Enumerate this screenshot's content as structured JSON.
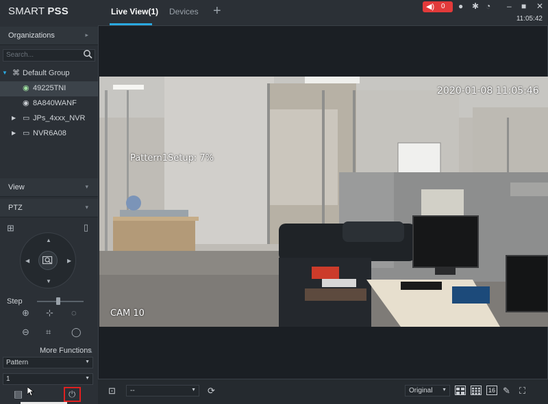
{
  "header": {
    "brand_prefix": "SMART ",
    "brand_bold": "PSS",
    "tabs": [
      {
        "label": "Live View(1)",
        "active": true
      },
      {
        "label": "Devices",
        "active": false
      }
    ],
    "alarm_count": "0",
    "clock": "11:05:42"
  },
  "sidebar": {
    "organizations_label": "Organizations",
    "search_placeholder": "Search...",
    "tree": {
      "group": "Default Group",
      "items": [
        "49225TNI",
        "8A840WANF",
        "JPs_4xxx_NVR",
        "NVR6A08"
      ]
    },
    "view_label": "View",
    "ptz_label": "PTZ",
    "step_label": "Step",
    "step_value": 0.45,
    "more_functions_label": "More Functions",
    "function_select": "Pattern",
    "number_select": "1"
  },
  "video": {
    "timestamp": "2020-01-08 11:05:46",
    "status_overlay": "Pattern1Setup: 7%",
    "camera_name": "CAM 10"
  },
  "toolbar": {
    "stream_select": "--",
    "ratio_select": "Original",
    "split_16_label": "16"
  },
  "colors": {
    "accent": "#2aa9e0",
    "alarm": "#e23a3a",
    "highlight": "#e02020"
  }
}
